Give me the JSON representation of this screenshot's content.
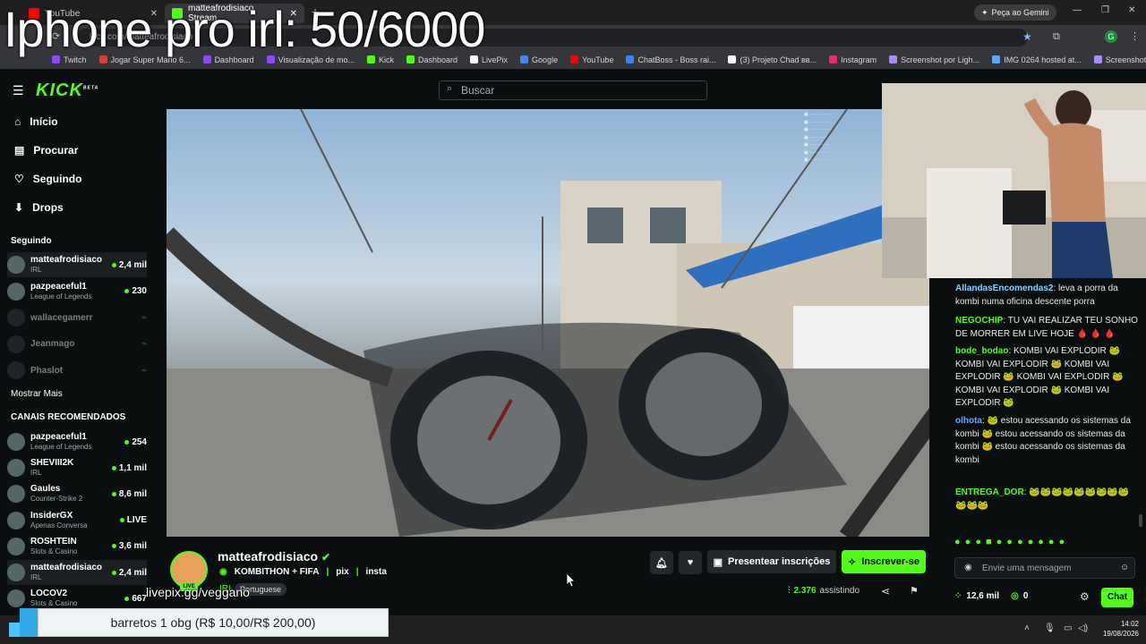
{
  "overlay_title": "Iphone pro irl: 50/6000",
  "browser": {
    "tabs": [
      {
        "label": "YouTube",
        "color": "#ff0000"
      },
      {
        "label": "matteafrodisiaco Stream",
        "color": "#53fc18"
      }
    ],
    "gemini_button": "Peça ao Gemini",
    "url": "kick.com/matteafrodisiaco",
    "bookmarks": [
      {
        "label": "Twitch",
        "color": "#9146ff"
      },
      {
        "label": "Jogar Super Mario 6...",
        "color": "#e53935"
      },
      {
        "label": "Dashboard",
        "color": "#9146ff"
      },
      {
        "label": "Visualização de mo...",
        "color": "#9146ff"
      },
      {
        "label": "Kick",
        "color": "#53fc18"
      },
      {
        "label": "Dashboard",
        "color": "#53fc18"
      },
      {
        "label": "LivePix",
        "color": "#ffffff"
      },
      {
        "label": "Google",
        "color": "#4285f4"
      },
      {
        "label": "YouTube",
        "color": "#ff0000"
      },
      {
        "label": "ChatBoss - Boss rai...",
        "color": "#3b82f6"
      },
      {
        "label": "(3) Projeto Chad вв...",
        "color": "#ffffff"
      },
      {
        "label": "Instagram",
        "color": "#e1306c"
      },
      {
        "label": "Screenshot por Ligh...",
        "color": "#a78bfa"
      },
      {
        "label": "IMG 0264 hosted at...",
        "color": "#60a5fa"
      },
      {
        "label": "Screenshot por Ligh...",
        "color": "#a78bfa"
      }
    ]
  },
  "kick": {
    "logo": "KICK",
    "logo_beta": "BETA",
    "search_placeholder": "Buscar",
    "nav": [
      {
        "label": "Início",
        "icon": "home-icon"
      },
      {
        "label": "Procurar",
        "icon": "browse-icon"
      },
      {
        "label": "Seguindo",
        "icon": "heart-icon"
      },
      {
        "label": "Drops",
        "icon": "drops-icon"
      }
    ],
    "following_title": "Seguindo",
    "following": [
      {
        "name": "matteafrodisiaco",
        "category": "IRL",
        "viewers": "2,4 mil",
        "live": true
      },
      {
        "name": "pazpeaceful1",
        "category": "League of Legends",
        "viewers": "230",
        "live": true
      },
      {
        "name": "wallacegamerr",
        "category": "",
        "viewers": "",
        "live": false
      },
      {
        "name": "Jeanmago",
        "category": "",
        "viewers": "",
        "live": false
      },
      {
        "name": "Phaslot",
        "category": "",
        "viewers": "",
        "live": false
      }
    ],
    "show_more": "Mostrar Mais",
    "recommended_title": "CANAIS RECOMENDADOS",
    "recommended": [
      {
        "name": "pazpeaceful1",
        "category": "League of Legends",
        "viewers": "254"
      },
      {
        "name": "SHEVIII2K",
        "category": "IRL",
        "viewers": "1,1 mil"
      },
      {
        "name": "Gaules",
        "category": "Counter-Strike 2",
        "viewers": "8,6 mil"
      },
      {
        "name": "InsiderGX",
        "category": "Apenas Conversa",
        "viewers": "LIVE"
      },
      {
        "name": "ROSHTEIN",
        "category": "Slots & Casino",
        "viewers": "3,6 mil"
      },
      {
        "name": "matteafrodisiaco",
        "category": "IRL",
        "viewers": "2,4 mil"
      },
      {
        "name": "LOCOV2",
        "category": "Slots & Casino",
        "viewers": "667"
      }
    ],
    "channel": {
      "name": "matteafrodisiaco",
      "title": "KOMBITHON + FIFA",
      "tags": [
        "pix",
        "insta"
      ],
      "category": "IRL",
      "language": "Portuguese",
      "live_badge": "LIVE",
      "viewers": "2.376",
      "viewers_label": "assistindo",
      "gift_button": "Presentear inscrições",
      "subscribe_button": "Inscrever-se"
    },
    "chat": {
      "messages": [
        {
          "user": "AllandasEncomendas2",
          "color": "#7dd3fc",
          "text": "leva a porra da kombi numa oficina descente porra"
        },
        {
          "user": "NEGOCHIP",
          "color": "#53fc18",
          "text": "TU VAI REALIZAR TEU SONHO DE MORRER EM LIVE HOJE 🩸 🩸 🩸"
        },
        {
          "user": "bode_bodao",
          "color": "#53fc18",
          "text": "KOMBI VAI EXPLODIR 🐸 KOMBI VAI EXPLODIR 🐸 KOMBI VAI EXPLODIR 🐸 KOMBI VAI EXPLODIR 🐸 KOMBI VAI EXPLODIR 🐸 KOMBI VAI EXPLODIR 🐸"
        },
        {
          "user": "olhota",
          "color": "#60a5fa",
          "text": "🐸 estou acessando os sistemas da kombi 🐸 estou acessando os sistemas da kombi 🐸 estou acessando os sistemas da kombi"
        },
        {
          "user": "ENTREGA_DOR",
          "color": "#53fc18",
          "text": "🐸🐸🐸🐸🐸🐸🐸🐸🐸🐸🐸🐸"
        }
      ],
      "input_placeholder": "Envie uma mensagem",
      "points": "12,6 mil",
      "zero": "0",
      "send_button": "Chat"
    }
  },
  "overlays": {
    "livepix": "livepix.gg/veggano",
    "donation_goal": "barretos 1 obg (R$ 10,00/R$ 200,00)"
  },
  "taskbar": {
    "time": "14:02",
    "date": "19/08/2026"
  }
}
